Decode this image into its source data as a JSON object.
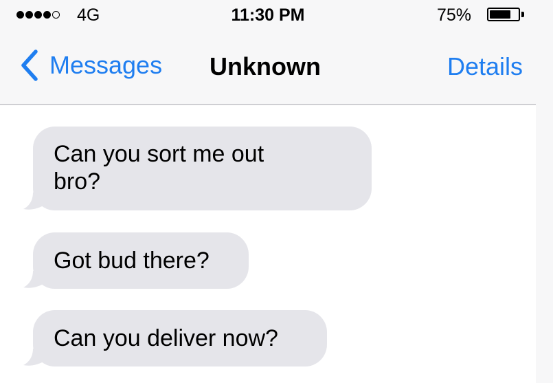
{
  "status_bar": {
    "signal_bars_filled": 4,
    "signal_bars_total": 5,
    "carrier": "4G",
    "time": "11:30 PM",
    "battery_percent_text": "75%",
    "battery_level": 0.75
  },
  "nav": {
    "back_label": "Messages",
    "title": "Unknown",
    "details_label": "Details"
  },
  "messages": [
    {
      "direction": "incoming",
      "text": "Can you sort me out\nbro?"
    },
    {
      "direction": "incoming",
      "text": "Got bud there?"
    },
    {
      "direction": "incoming",
      "text": "Can you deliver now?"
    }
  ],
  "colors": {
    "accent": "#1f7ef0",
    "incoming_bubble": "#e5e5ea",
    "bar_background": "#f7f7f8"
  },
  "icons": [
    "back-chevron-icon",
    "signal-dots-icon",
    "battery-icon"
  ]
}
